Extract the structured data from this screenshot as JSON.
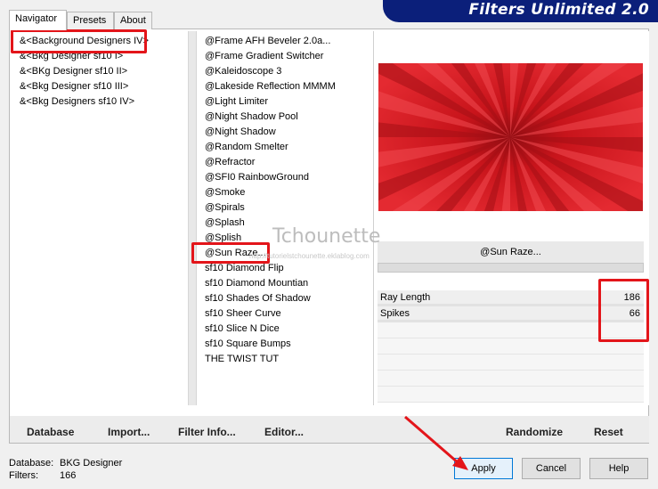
{
  "app": {
    "title": "Filters Unlimited 2.0"
  },
  "tabs": [
    {
      "label": "Navigator",
      "active": true
    },
    {
      "label": "Presets",
      "active": false
    },
    {
      "label": "About",
      "active": false
    }
  ],
  "categories": [
    "&<Background Designers IV>",
    "&<Bkg Designer sf10 I>",
    "&<BKg Designer sf10 II>",
    "&<Bkg Designer sf10 III>",
    "&<Bkg Designers sf10 IV>"
  ],
  "filters": [
    "@Frame AFH Beveler 2.0a...",
    "@Frame Gradient Switcher",
    "@Kaleidoscope 3",
    "@Lakeside Reflection MMMM",
    "@Light Limiter",
    "@Night Shadow Pool",
    "@Night Shadow",
    "@Random Smelter",
    "@Refractor",
    "@SFI0 RainbowGround",
    "@Smoke",
    "@Spirals",
    "@Splash",
    "@Splish",
    "@Sun Raze...",
    "sf10 Diamond Flip",
    "sf10 Diamond Mountian",
    "sf10 Shades Of Shadow",
    "sf10 Sheer Curve",
    "sf10 Slice N Dice",
    "sf10 Square Bumps",
    "THE TWIST TUT"
  ],
  "selected_filter": "@Sun Raze...",
  "params": [
    {
      "label": "Ray Length",
      "value": "186"
    },
    {
      "label": "Spikes",
      "value": "66"
    }
  ],
  "buttons": {
    "database": "Database",
    "import": "Import...",
    "filter_info": "Filter Info...",
    "editor": "Editor...",
    "randomize": "Randomize",
    "reset": "Reset",
    "apply": "Apply",
    "cancel": "Cancel",
    "help": "Help"
  },
  "status": {
    "database_label": "Database:",
    "database_value": "BKG Designer",
    "filters_label": "Filters:",
    "filters_value": "166"
  },
  "watermark": {
    "title": "Tchounette",
    "url": "http://tutorielstchounette.eklablog.com"
  },
  "colors": {
    "accent_red": "#e3151a",
    "banner_blue": "#0b1f7a",
    "preview_red": "#d81b23"
  }
}
